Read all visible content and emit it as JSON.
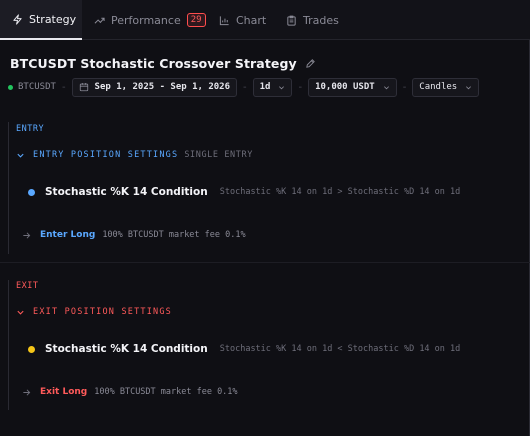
{
  "tabs": [
    {
      "label": "Strategy",
      "icon": "bolt-icon",
      "active": true
    },
    {
      "label": "Performance",
      "icon": "trend-up-icon",
      "badge": "29"
    },
    {
      "label": "Chart",
      "icon": "chart-icon"
    },
    {
      "label": "Trades",
      "icon": "clipboard-icon"
    }
  ],
  "strategy": {
    "title": "BTCUSDT Stochastic Crossover Strategy"
  },
  "toolbar": {
    "symbol": "BTCUSDT",
    "separator": "-",
    "date_range": "Sep 1, 2025 - Sep 1, 2026",
    "interval": "1d",
    "capital": "10,000 USDT",
    "chart_type": "Candles"
  },
  "entry": {
    "label": "ENTRY",
    "settings_label": "ENTRY POSITION SETTINGS",
    "settings_extra": "SINGLE ENTRY",
    "condition_title": "Stochastic %K 14 Condition",
    "condition_expr": "Stochastic %K 14 on 1d > Stochastic %D 14 on 1d",
    "action_label": "Enter Long",
    "action_detail": "100% BTCUSDT market fee 0.1%"
  },
  "exit": {
    "label": "EXIT",
    "settings_label": "EXIT POSITION SETTINGS",
    "condition_title": "Stochastic %K 14 Condition",
    "condition_expr": "Stochastic %K 14 on 1d < Stochastic %D 14 on 1d",
    "action_label": "Exit Long",
    "action_detail": "100% BTCUSDT market fee 0.1%"
  },
  "colors": {
    "entry_accent": "#5aa8ff",
    "exit_accent": "#ff5a5a",
    "entry_dot": "#5aa8ff",
    "exit_dot": "#f5c518",
    "symbol_dot": "#22c55e"
  }
}
